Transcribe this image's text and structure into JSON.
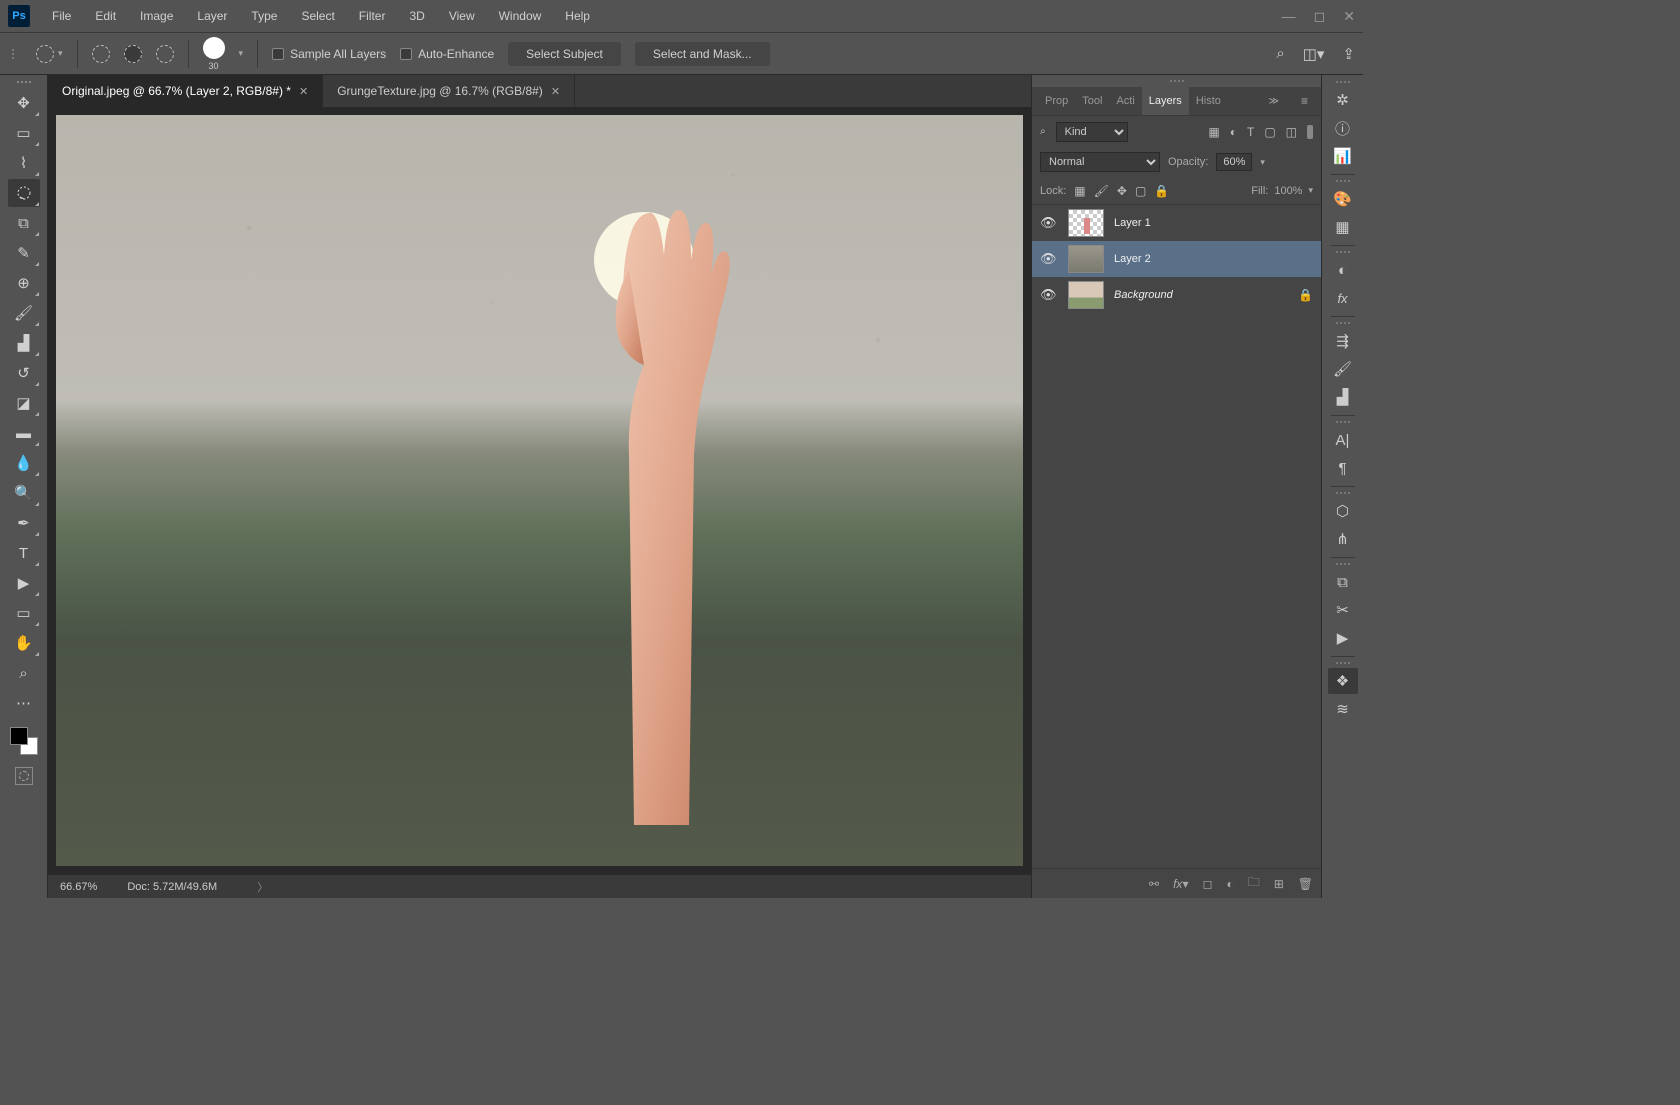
{
  "menu": {
    "file": "File",
    "edit": "Edit",
    "image": "Image",
    "layer": "Layer",
    "type": "Type",
    "select": "Select",
    "filter": "Filter",
    "threeD": "3D",
    "view": "View",
    "window": "Window",
    "help": "Help"
  },
  "options": {
    "brush_size": "30",
    "sample_all_layers": "Sample All Layers",
    "auto_enhance": "Auto-Enhance",
    "select_subject": "Select Subject",
    "select_and_mask": "Select and Mask..."
  },
  "tabs": [
    {
      "label": "Original.jpeg @ 66.7% (Layer 2, RGB/8#) *",
      "active": true
    },
    {
      "label": "GrungeTexture.jpg @ 16.7% (RGB/8#)",
      "active": false
    }
  ],
  "status": {
    "zoom": "66.67%",
    "doc": "Doc: 5.72M/49.6M"
  },
  "panel_tabs": {
    "prop": "Prop",
    "tool": "Tool",
    "acti": "Acti",
    "layers": "Layers",
    "histo": "Histo"
  },
  "layers_panel": {
    "kind_label": "Kind",
    "blend_mode": "Normal",
    "opacity_label": "Opacity:",
    "opacity_value": "60%",
    "lock_label": "Lock:",
    "fill_label": "Fill:",
    "fill_value": "100%",
    "items": [
      {
        "name": "Layer 1",
        "thumb": "checker",
        "visible": true,
        "selected": false,
        "italic": false,
        "locked": false
      },
      {
        "name": "Layer 2",
        "thumb": "texture",
        "visible": true,
        "selected": true,
        "italic": false,
        "locked": false
      },
      {
        "name": "Background",
        "thumb": "bg",
        "visible": true,
        "selected": false,
        "italic": true,
        "locked": true
      }
    ]
  }
}
